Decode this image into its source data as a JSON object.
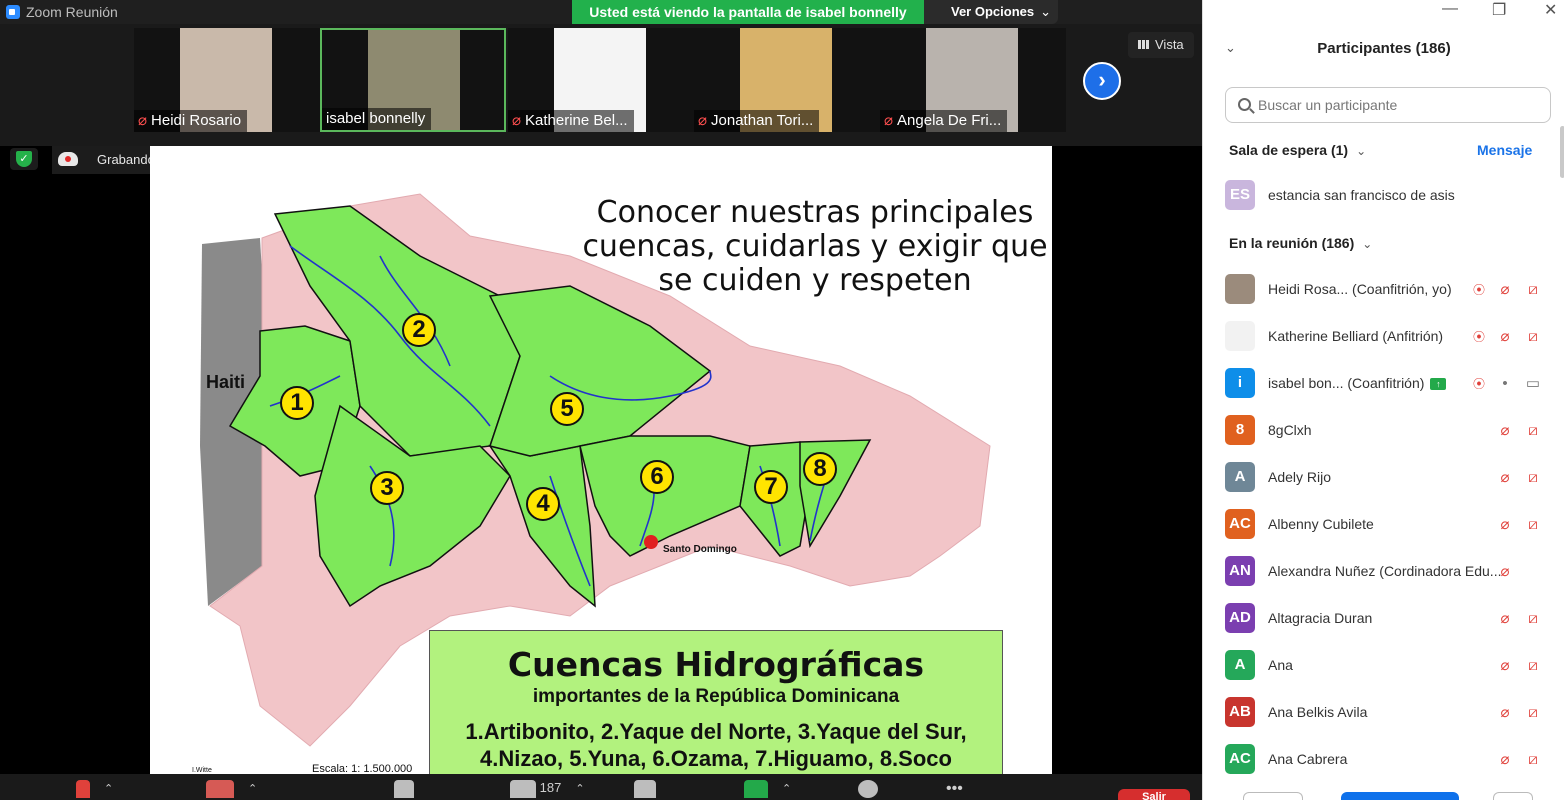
{
  "window": {
    "title": "Zoom Reunión"
  },
  "banner": {
    "text": "Usted está viendo la pantalla de isabel bonnelly",
    "view_options": "Ver Opciones"
  },
  "video_strip": {
    "view_label": "Vista",
    "tiles": [
      {
        "name": "Heidi Rosario",
        "muted": true,
        "active": false,
        "bg": "#c9b9aa"
      },
      {
        "name": "isabel bonnelly",
        "muted": false,
        "active": true,
        "bg": "#8e8a70"
      },
      {
        "name": "Katherine Bel...",
        "muted": true,
        "active": false,
        "bg": "#f4f4f4"
      },
      {
        "name": "Jonathan Tori...",
        "muted": true,
        "active": false,
        "bg": "#d8b26a"
      },
      {
        "name": "Angela De Fri...",
        "muted": true,
        "active": false,
        "bg": "#b9b3ad"
      }
    ]
  },
  "recording": {
    "label": "Grabando..."
  },
  "slide": {
    "title_lines": [
      "Conocer nuestras principales",
      "cuencas, cuidarlas  y exigir que",
      "se cuiden  y respeten"
    ],
    "map_label_haiti": "Haiti",
    "capital_label": "Santo Domingo",
    "scale_label": "Escala: 1: 1.500.000",
    "credit_label": "I.Witte",
    "basin_numbers": [
      "1",
      "2",
      "3",
      "4",
      "5",
      "6",
      "7",
      "8"
    ],
    "legend": {
      "title": "Cuencas Hidrográficas",
      "subtitle": "importantes de la República Dominicana",
      "line1": "1.Artibonito, 2.Yaque del Norte, 3.Yaque del Sur,",
      "line2": "4.Nizao, 5.Yuna, 6.Ozama, 7.Higuamo, 8.Soco"
    },
    "colors": {
      "basin": "#7ee85a",
      "land": "#f2c5c8",
      "haiti": "#8a8a8a",
      "river": "#2233cc"
    }
  },
  "toolbar": {
    "participant_count": "187",
    "leave_label": "Salir"
  },
  "panel": {
    "title": "Participantes (186)",
    "search_placeholder": "Buscar un participante",
    "waiting_header": "Sala de espera (1)",
    "message_button": "Mensaje",
    "waiting": [
      {
        "initials": "ES",
        "name": "estancia san francisco de asis",
        "color": "#c9b6dd"
      }
    ],
    "in_meeting_header": "En la reunión (186)",
    "participants": [
      {
        "initials": "",
        "name": "Heidi Rosa... (Coanfitrión, yo)",
        "color": "#9b8b7c",
        "recording": true,
        "mic": "off",
        "cam": "off",
        "sharing": false
      },
      {
        "initials": "",
        "name": "Katherine Belliard (Anfitrión)",
        "color": "#f2f2f2",
        "recording": true,
        "mic": "off",
        "cam": "off",
        "sharing": false
      },
      {
        "initials": "i",
        "name": "isabel bon... (Coanfitrión)",
        "color": "#0e8ee9",
        "recording": true,
        "mic": "on",
        "cam": "on",
        "sharing": true
      },
      {
        "initials": "8",
        "name": "8gClxh",
        "color": "#e0611f",
        "recording": false,
        "mic": "off",
        "cam": "off",
        "sharing": false
      },
      {
        "initials": "A",
        "name": "Adely Rijo",
        "color": "#6f8797",
        "recording": false,
        "mic": "off",
        "cam": "off",
        "sharing": false
      },
      {
        "initials": "AC",
        "name": "Albenny Cubilete",
        "color": "#e0611f",
        "recording": false,
        "mic": "off",
        "cam": "off",
        "sharing": false
      },
      {
        "initials": "AN",
        "name": "Alexandra Nuñez (Cordinadora Edu...",
        "color": "#7b3fb0",
        "recording": false,
        "mic": "off",
        "cam": "",
        "sharing": false
      },
      {
        "initials": "AD",
        "name": "Altagracia Duran",
        "color": "#7b3fb0",
        "recording": false,
        "mic": "off",
        "cam": "off",
        "sharing": false
      },
      {
        "initials": "A",
        "name": "Ana",
        "color": "#25a85a",
        "recording": false,
        "mic": "off",
        "cam": "off",
        "sharing": false
      },
      {
        "initials": "AB",
        "name": "Ana Belkis Avila",
        "color": "#c8352e",
        "recording": false,
        "mic": "off",
        "cam": "off",
        "sharing": false
      },
      {
        "initials": "AC",
        "name": "Ana Cabrera",
        "color": "#25a85a",
        "recording": false,
        "mic": "off",
        "cam": "off",
        "sharing": false
      }
    ]
  }
}
